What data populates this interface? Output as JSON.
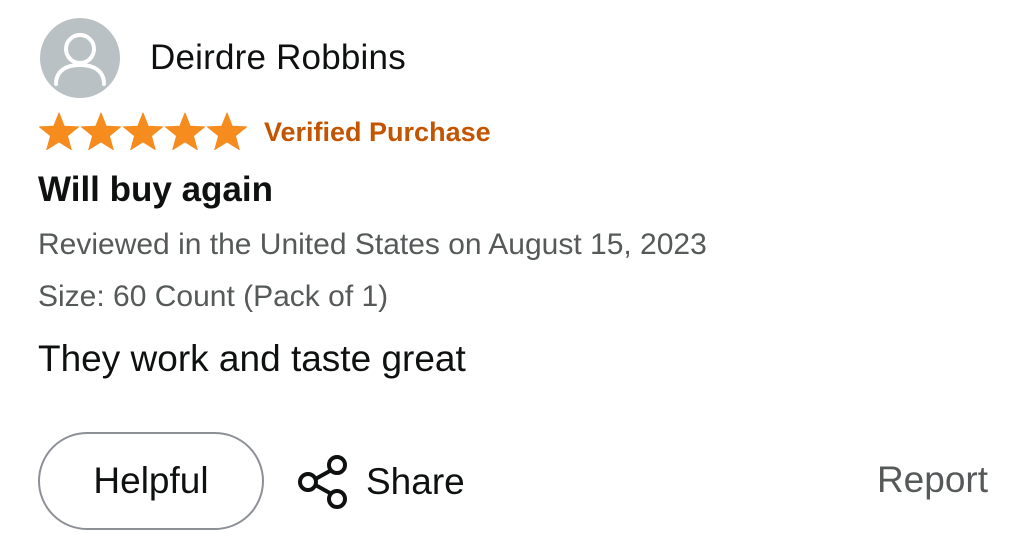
{
  "review": {
    "author": {
      "name": "Deirdre Robbins",
      "avatar_icon": "user-avatar-icon"
    },
    "rating": {
      "stars": 5,
      "max_stars": 5,
      "star_color": "#f68b1e",
      "verified_label": "Verified Purchase",
      "verified_color": "#c45500"
    },
    "title": "Will buy again",
    "meta": "Reviewed in the United States on August 15, 2023",
    "size": "Size: 60 Count (Pack of 1)",
    "body": "They work and taste great"
  },
  "actions": {
    "helpful_label": "Helpful",
    "share_label": "Share",
    "share_icon": "share-icon",
    "report_label": "Report"
  }
}
